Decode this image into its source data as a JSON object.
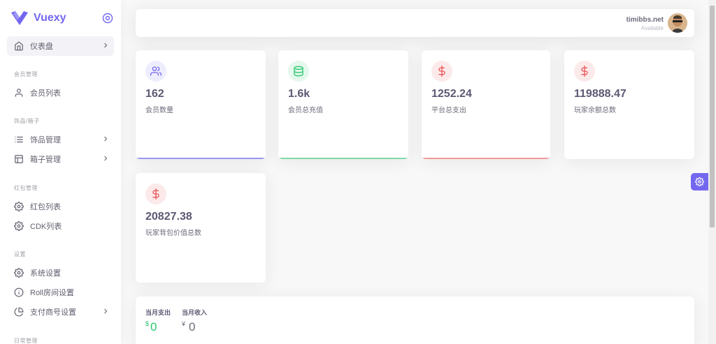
{
  "brand": {
    "name": "Vuexy",
    "color": "#7367f0"
  },
  "sidebar": {
    "dashboard": {
      "label": "仪表盘"
    },
    "sections": {
      "members": "会员管理",
      "items": "饰品/箱子",
      "redpacket": "红包管理",
      "settings": "设置",
      "daily": "日常管理"
    },
    "items": {
      "member_list": "会员列表",
      "item_manage": "饰品管理",
      "box_manage": "箱子管理",
      "redpacket_list": "红包列表",
      "cdk_list": "CDK列表",
      "system_settings": "系统设置",
      "roll_settings": "Roll房间设置",
      "payment_settings": "支付商号设置"
    }
  },
  "navbar": {
    "user_name": "timibbs.net",
    "user_status": "Available"
  },
  "stats": [
    {
      "value": "162",
      "label": "会员数量",
      "icon": "users-icon",
      "color": "#7367f0"
    },
    {
      "value": "1.6k",
      "label": "会员总充值",
      "icon": "database-icon",
      "color": "#28c76f"
    },
    {
      "value": "1252.24",
      "label": "平台总支出",
      "icon": "dollar-icon",
      "color": "#ea5455"
    },
    {
      "value": "119888.47",
      "label": "玩家余额总数",
      "icon": "dollar-icon",
      "color": "#ea5455"
    },
    {
      "value": "20827.38",
      "label": "玩家背包价值总数",
      "icon": "dollar-icon",
      "color": "#ea5455"
    }
  ],
  "monthly": {
    "expense_title": "当月支出",
    "expense_currency": "$",
    "expense_value": "0",
    "income_title": "当月收入",
    "income_currency": "¥",
    "income_value": "0"
  }
}
